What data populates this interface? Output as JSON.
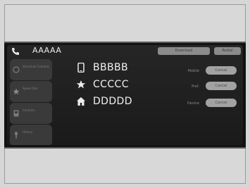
{
  "header": {
    "title": "AAAAA",
    "phone_icon": "phone-icon",
    "buttons": [
      {
        "label": "Download"
      },
      {
        "label": "Redial"
      }
    ]
  },
  "sidebar": {
    "items": [
      {
        "label": "Voicemail Contacts",
        "icon": "voicemail-icon"
      },
      {
        "label": "Speed Dial",
        "icon": "star-icon"
      },
      {
        "label": "Contacts",
        "icon": "contacts-book-icon"
      },
      {
        "label": "History",
        "icon": "history-icon"
      }
    ]
  },
  "contacts": [
    {
      "name": "BBBBB",
      "icon": "mobile-phone-icon",
      "type_label": "Mobile",
      "action_label": "Cancel"
    },
    {
      "name": "CCCCC",
      "icon": "star-icon",
      "type_label": "Pref.",
      "action_label": "Cancel"
    },
    {
      "name": "DDDDD",
      "icon": "home-icon",
      "type_label": "Device",
      "action_label": "Cancel"
    }
  ],
  "colors": {
    "screen_bg": "#1a1a1a",
    "text_primary": "#f2f2f2",
    "button_bg": "#a2a2a2"
  }
}
